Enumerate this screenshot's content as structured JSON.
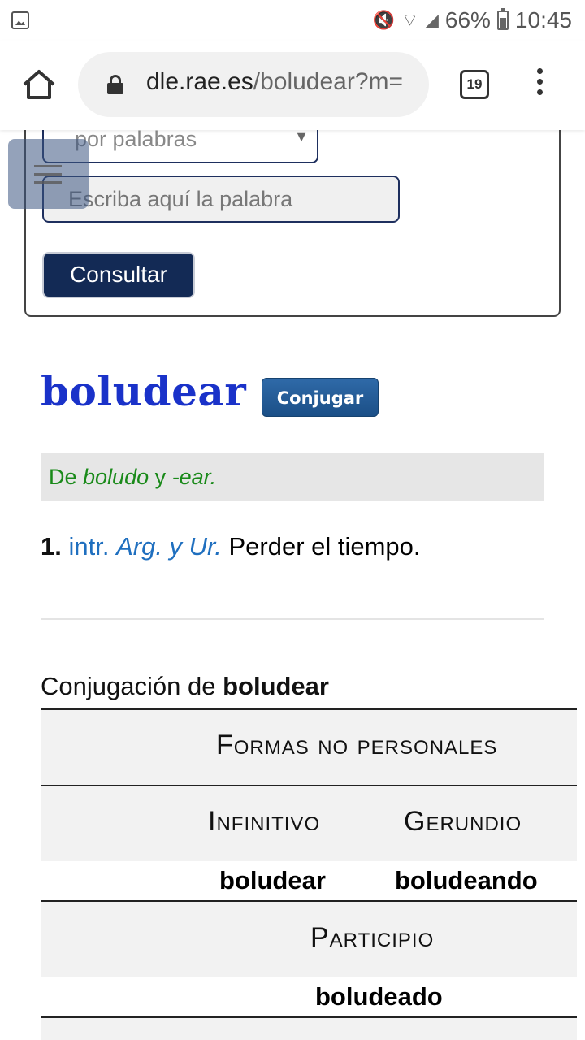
{
  "status_bar": {
    "battery": "66%",
    "time": "10:45",
    "icons": [
      "gallery-icon",
      "mute-icon",
      "wifi-icon",
      "signal-icon",
      "battery-icon"
    ]
  },
  "browser": {
    "url_domain": "dle.rae.es",
    "url_path": "/boludear?m=",
    "tab_count": "19"
  },
  "search": {
    "mode_selected": "por palabras",
    "input_placeholder": "Escriba aquí la palabra",
    "submit_label": "Consultar"
  },
  "entry": {
    "headword": "boludear",
    "conjugate_label": "Conjugar",
    "etymology": {
      "prefix": "De",
      "base": "boludo",
      "joiner": "y",
      "suffix": "-ear."
    },
    "definition": {
      "number": "1.",
      "category": "intr.",
      "region": "Arg. y Ur.",
      "text": "Perder el tiempo."
    }
  },
  "conjugation": {
    "title_prefix": "Conjugación de",
    "title_word": "boludear",
    "section_title": "Formas no personales",
    "infinitive_label": "Infinitivo",
    "infinitive": "boludear",
    "gerund_label": "Gerundio",
    "gerund": "boludeando",
    "participle_label": "Participio",
    "participle": "boludeado"
  },
  "colors": {
    "headword": "#1a32c9",
    "etymology": "#1a8a1a",
    "abbreviation": "#1f6fbf",
    "button_dark": "#132a55"
  }
}
